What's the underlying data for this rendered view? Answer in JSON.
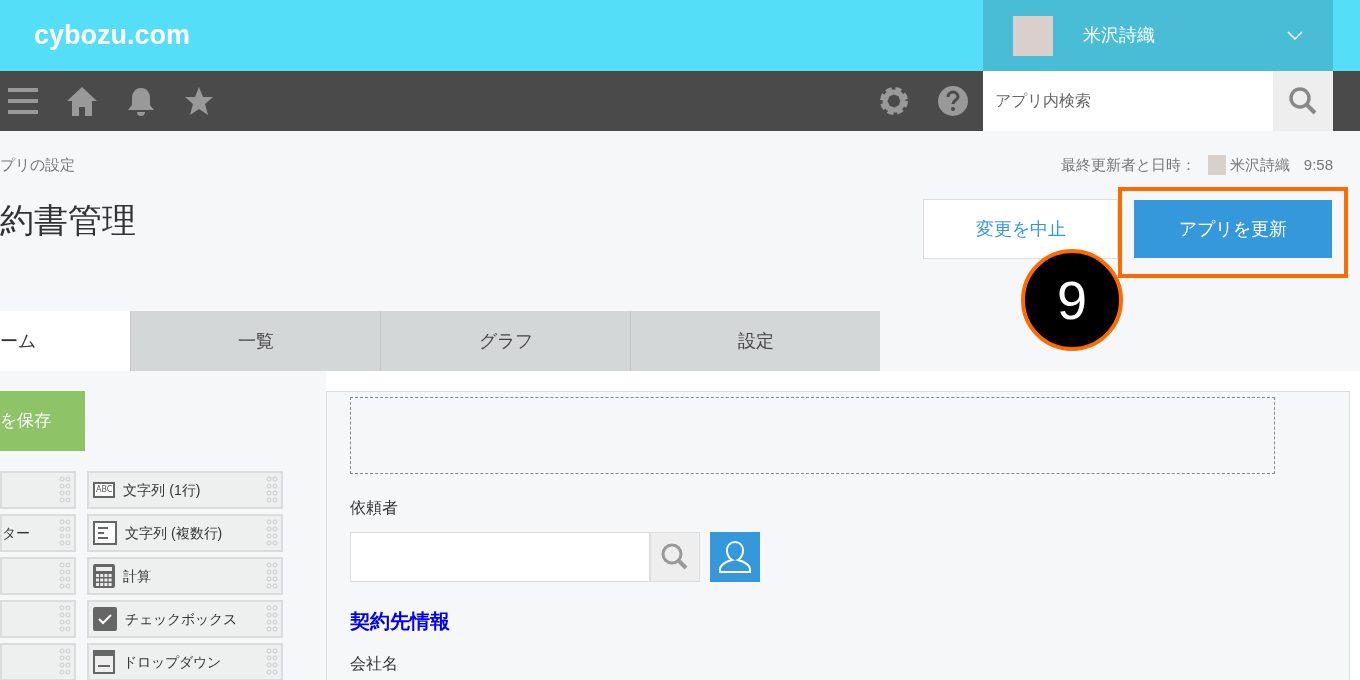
{
  "header": {
    "logo": "cybozu.com",
    "user": {
      "name": "米沢詩織"
    }
  },
  "toolbar": {
    "search": {
      "placeholder": "アプリ内検索"
    }
  },
  "breadcrumb": "プリの設定",
  "last_updated": {
    "label": "最終更新者と日時：",
    "user": "米沢詩織",
    "time": "9:58"
  },
  "title": "約書管理",
  "buttons": {
    "cancel": "変更を中止",
    "update": "アプリを更新"
  },
  "annotation": {
    "number": "9"
  },
  "tabs": [
    {
      "label": "ーム",
      "selected": true
    },
    {
      "label": "一覧",
      "selected": false
    },
    {
      "label": "グラフ",
      "selected": false
    },
    {
      "label": "設定",
      "selected": false
    }
  ],
  "save_button": "を保存",
  "palette": [
    {
      "right": "文字列 (1行)",
      "kind": "single_line",
      "icon_text": "ABC"
    },
    {
      "left": "ター",
      "right": "文字列 (複数行)",
      "kind": "multi_line"
    },
    {
      "right": "計算",
      "kind": "calc"
    },
    {
      "right": "チェックボックス",
      "kind": "check"
    },
    {
      "right": "ドロップダウン",
      "kind": "dropdown"
    }
  ],
  "form": {
    "user_field": {
      "label": "依頼者"
    },
    "section_label": "契約先情報",
    "field_label": "会社名"
  }
}
